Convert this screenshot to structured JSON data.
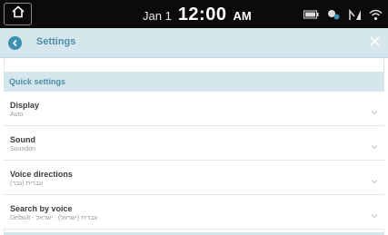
{
  "statusbar": {
    "date": "Jan 1",
    "time": "12:00",
    "ampm": "AM",
    "icons": [
      "home-icon",
      "battery-icon",
      "gps-icon",
      "signal-icon",
      "wifi-icon"
    ]
  },
  "titlebar": {
    "title": "Settings",
    "back_icon": "back-icon",
    "close_icon": "close-icon"
  },
  "section": {
    "header": "Quick settings"
  },
  "items": [
    {
      "label": "Display",
      "value": "Auto"
    },
    {
      "label": "Sound",
      "value": "Soundon"
    },
    {
      "label": "Voice directions",
      "value": "עברית (גבר)"
    },
    {
      "label": "Search by voice",
      "value": "Default - עברית (ישראל) . ישראל"
    }
  ],
  "colors": {
    "accent": "#4f8ea7",
    "header_bg": "#d5e6ec",
    "statusbar_bg": "#0b0b0b"
  }
}
